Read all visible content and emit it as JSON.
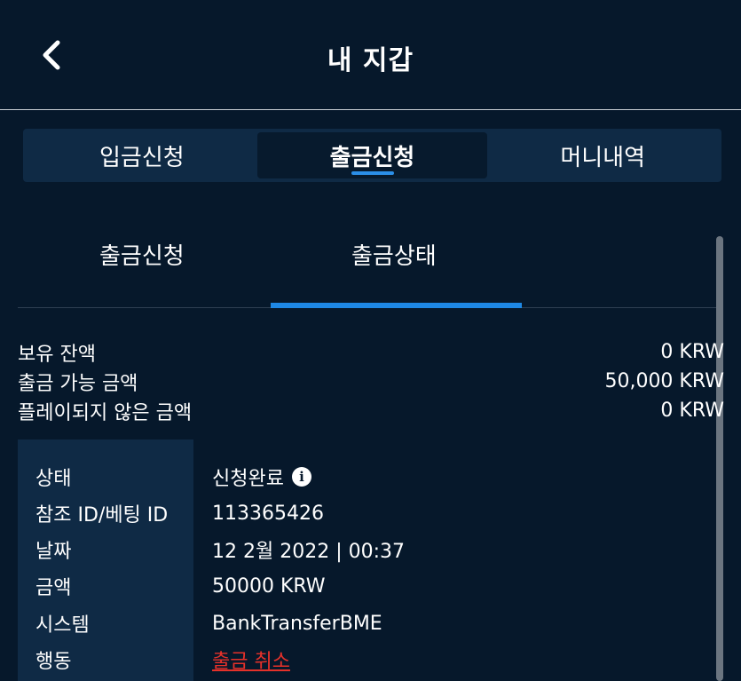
{
  "header": {
    "title": "내 지갑"
  },
  "main_tabs": [
    {
      "label": "입금신청"
    },
    {
      "label": "출금신청"
    },
    {
      "label": "머니내역"
    }
  ],
  "sub_tabs": [
    {
      "label": "출금신청"
    },
    {
      "label": "출금상태"
    }
  ],
  "balances": [
    {
      "label": "보유 잔액",
      "value": "0 KRW"
    },
    {
      "label": "출금 가능 금액",
      "value": "50,000 KRW"
    },
    {
      "label": "플레이되지 않은 금액",
      "value": "0 KRW"
    }
  ],
  "details": {
    "status_label": "상태",
    "status_value": "신청완료",
    "ref_label": "참조 ID/베팅 ID",
    "ref_value": "113365426",
    "date_label": "날짜",
    "date_value": "12 2월 2022 | 00:37",
    "amount_label": "금액",
    "amount_value": "50000 KRW",
    "system_label": "시스템",
    "system_value": "BankTransferBME",
    "action_label": "행동",
    "action_value": "출금 취소"
  },
  "colors": {
    "background": "#06182b",
    "tab_bar": "#0f2a45",
    "accent": "#1e88e5",
    "cancel": "#e5312a"
  }
}
